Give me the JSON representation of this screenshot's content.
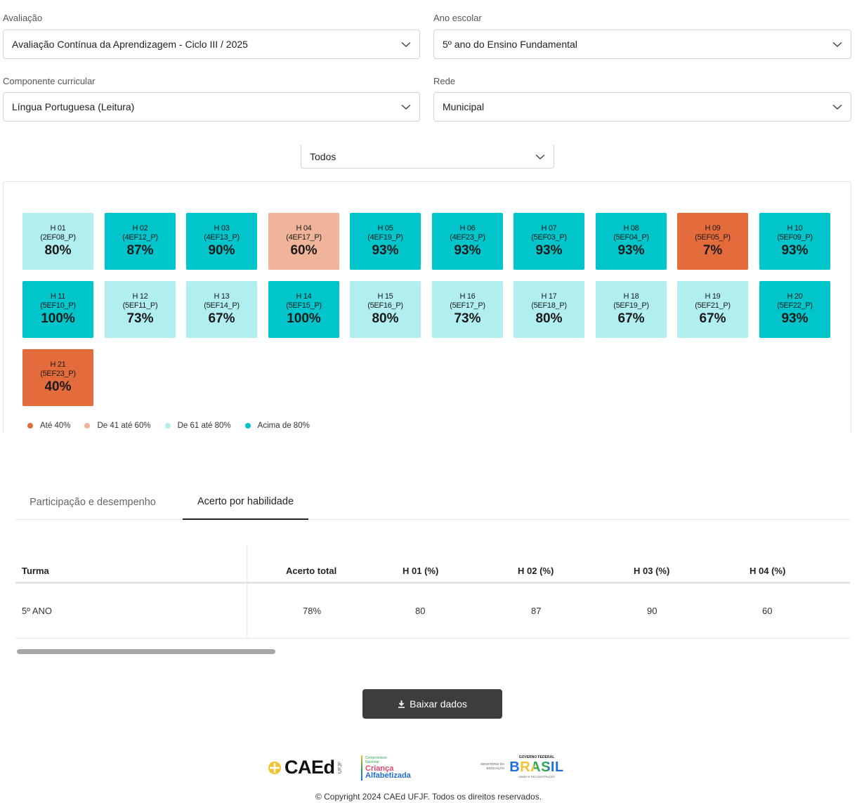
{
  "filters": {
    "avaliacao": {
      "label": "Avaliação",
      "value": "Avaliação Contínua da Aprendizagem - Ciclo III / 2025"
    },
    "ano_escolar": {
      "label": "Ano escolar",
      "value": "5º ano do Ensino Fundamental"
    },
    "componente": {
      "label": "Componente curricular",
      "value": "Língua Portuguesa (Leitura)"
    },
    "rede": {
      "label": "Rede",
      "value": "Municipal"
    },
    "escopo": {
      "value": "Todos"
    }
  },
  "colors": {
    "ate_40": "#e46b3c",
    "de_41_a_60": "#f0b49a",
    "de_61_a_80": "#b1eef0",
    "acima_80": "#00c6cc"
  },
  "skills": [
    {
      "id": "H 01",
      "code": "(2EF08_P)",
      "pct": "80%",
      "level": "de_61_a_80"
    },
    {
      "id": "H 02",
      "code": "(4EF12_P)",
      "pct": "87%",
      "level": "acima_80"
    },
    {
      "id": "H 03",
      "code": "(4EF13_P)",
      "pct": "90%",
      "level": "acima_80"
    },
    {
      "id": "H 04",
      "code": "(4EF17_P)",
      "pct": "60%",
      "level": "de_41_a_60"
    },
    {
      "id": "H 05",
      "code": "(4EF19_P)",
      "pct": "93%",
      "level": "acima_80"
    },
    {
      "id": "H 06",
      "code": "(4EF23_P)",
      "pct": "93%",
      "level": "acima_80"
    },
    {
      "id": "H 07",
      "code": "(5EF03_P)",
      "pct": "93%",
      "level": "acima_80"
    },
    {
      "id": "H 08",
      "code": "(5EF04_P)",
      "pct": "93%",
      "level": "acima_80"
    },
    {
      "id": "H 09",
      "code": "(5EF05_P)",
      "pct": "7%",
      "level": "ate_40"
    },
    {
      "id": "H 10",
      "code": "(5EF09_P)",
      "pct": "93%",
      "level": "acima_80"
    },
    {
      "id": "H 11",
      "code": "(5EF10_P)",
      "pct": "100%",
      "level": "acima_80"
    },
    {
      "id": "H 12",
      "code": "(5EF11_P)",
      "pct": "73%",
      "level": "de_61_a_80"
    },
    {
      "id": "H 13",
      "code": "(5EF14_P)",
      "pct": "67%",
      "level": "de_61_a_80"
    },
    {
      "id": "H 14",
      "code": "(5EF15_P)",
      "pct": "100%",
      "level": "acima_80"
    },
    {
      "id": "H 15",
      "code": "(5EF16_P)",
      "pct": "80%",
      "level": "de_61_a_80"
    },
    {
      "id": "H 16",
      "code": "(5EF17_P)",
      "pct": "73%",
      "level": "de_61_a_80"
    },
    {
      "id": "H 17",
      "code": "(5EF18_P)",
      "pct": "80%",
      "level": "de_61_a_80"
    },
    {
      "id": "H 18",
      "code": "(5EF19_P)",
      "pct": "67%",
      "level": "de_61_a_80"
    },
    {
      "id": "H 19",
      "code": "(5EF21_P)",
      "pct": "67%",
      "level": "de_61_a_80"
    },
    {
      "id": "H 20",
      "code": "(5EF22_P)",
      "pct": "93%",
      "level": "acima_80"
    },
    {
      "id": "H 21",
      "code": "(5EF23_P)",
      "pct": "40%",
      "level": "ate_40"
    }
  ],
  "legend": [
    {
      "key": "ate_40",
      "label": "Até 40%"
    },
    {
      "key": "de_41_a_60",
      "label": "De 41 até 60%"
    },
    {
      "key": "de_61_a_80",
      "label": "De 61 até 80%"
    },
    {
      "key": "acima_80",
      "label": "Acima de 80%"
    }
  ],
  "tabs": [
    {
      "label": "Participação e desempenho"
    },
    {
      "label": "Acerto por habilidade"
    }
  ],
  "active_tab": "Acerto por habilidade",
  "table": {
    "headers": [
      "Turma",
      "Acerto total",
      "H 01 (%)",
      "H 02 (%)",
      "H 03 (%)",
      "H 04 (%)"
    ],
    "rows": [
      [
        "5º ANO",
        "78%",
        "80",
        "87",
        "90",
        "60"
      ]
    ]
  },
  "download_label": "Baixar dados",
  "footer": {
    "logo_caed": "CAEd",
    "logo_caed_sub": "UFJF",
    "logo_crianca_top": "Compromisso Nacional",
    "logo_crianca_1": "Criança",
    "logo_crianca_2": "Alfabetizada",
    "logo_ministerio": "MINISTÉRIO DA EDUCAÇÃO",
    "logo_gov_top": "GOVERNO FEDERAL",
    "logo_gov_brasil": "BRASIL",
    "logo_gov_sub": "UNIÃO E RECONSTRUÇÃO",
    "copyright": "© Copyright 2024 CAEd UFJF. Todos os direitos reservados."
  }
}
